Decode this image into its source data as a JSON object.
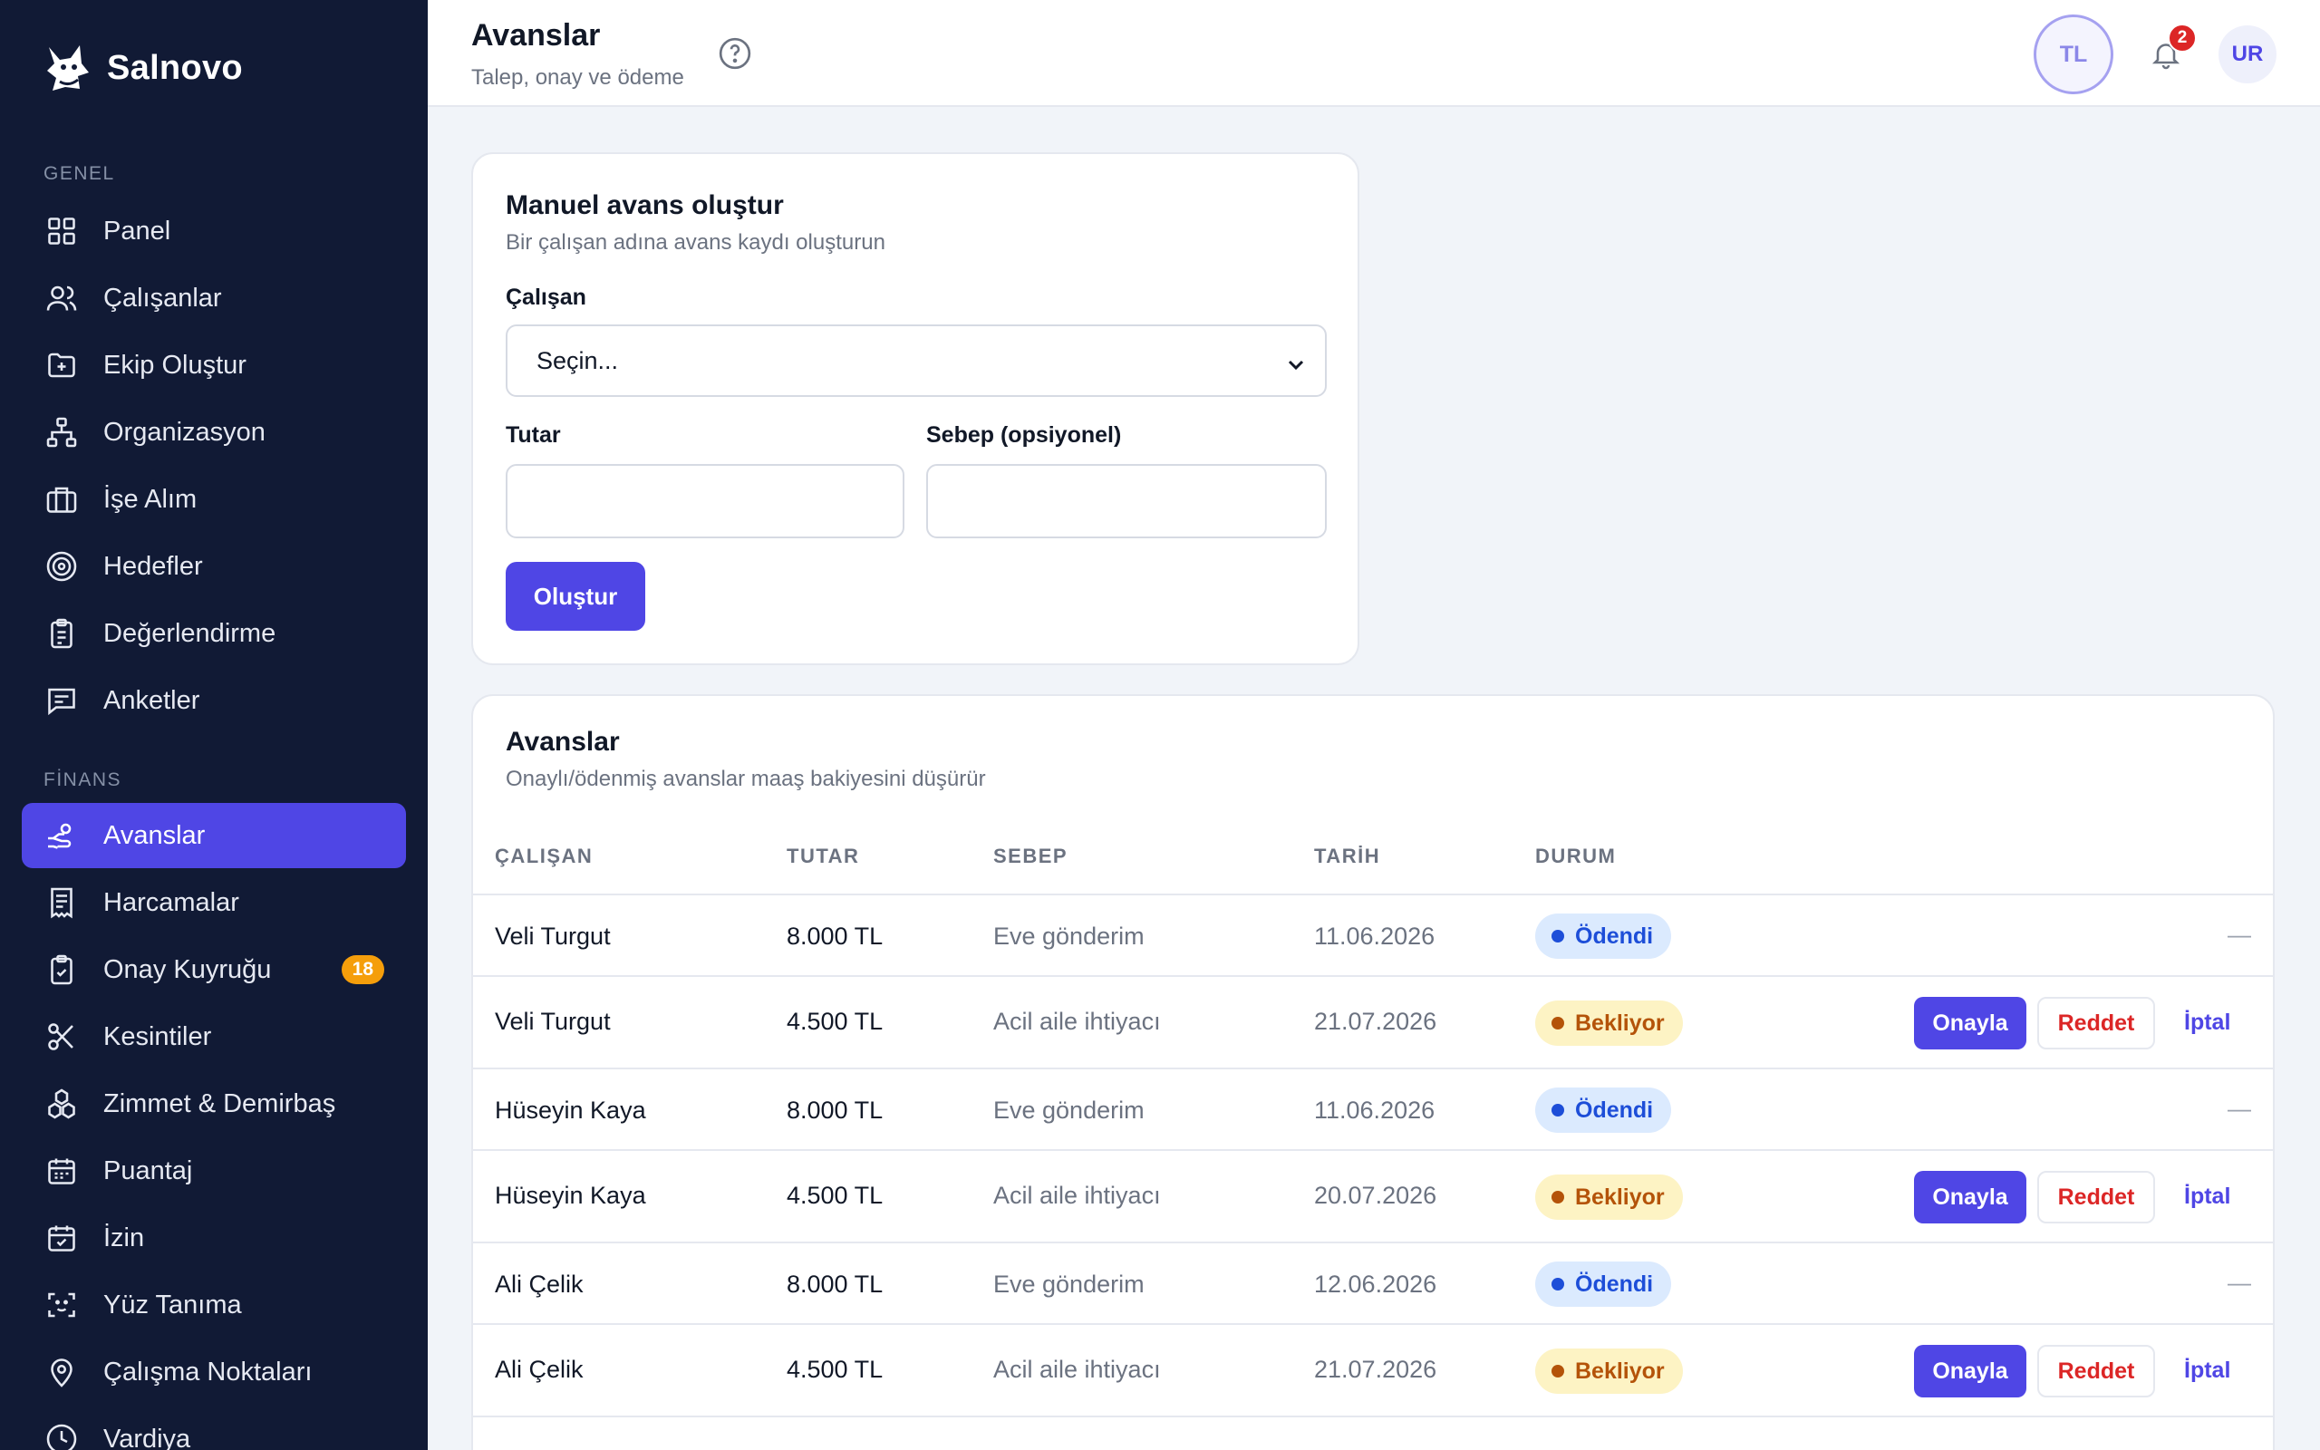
{
  "brand": {
    "name": "Salnovo"
  },
  "sidebar": {
    "sections": [
      {
        "title": "GENEL"
      },
      {
        "title": "FİNANS"
      }
    ],
    "items": [
      {
        "label": "Panel",
        "icon": "grid-icon"
      },
      {
        "label": "Çalışanlar",
        "icon": "users-icon"
      },
      {
        "label": "Ekip Oluştur",
        "icon": "folder-plus-icon"
      },
      {
        "label": "Organizasyon",
        "icon": "org-chart-icon"
      },
      {
        "label": "İşe Alım",
        "icon": "briefcase-icon"
      },
      {
        "label": "Hedefler",
        "icon": "target-icon"
      },
      {
        "label": "Değerlendirme",
        "icon": "clipboard-icon"
      },
      {
        "label": "Anketler",
        "icon": "chat-icon"
      },
      {
        "label": "Avanslar",
        "icon": "hand-coin-icon",
        "active": true
      },
      {
        "label": "Harcamalar",
        "icon": "receipt-icon"
      },
      {
        "label": "Onay Kuyruğu",
        "icon": "clipboard-check-icon",
        "badge": "18"
      },
      {
        "label": "Kesintiler",
        "icon": "scissors-icon"
      },
      {
        "label": "Zimmet & Demirbaş",
        "icon": "boxes-icon"
      },
      {
        "label": "Puantaj",
        "icon": "calendar-icon"
      },
      {
        "label": "İzin",
        "icon": "calendar-check-icon"
      },
      {
        "label": "Yüz Tanıma",
        "icon": "face-scan-icon"
      },
      {
        "label": "Çalışma Noktaları",
        "icon": "map-pin-icon"
      },
      {
        "label": "Vardiya",
        "icon": "clock-icon"
      }
    ]
  },
  "header": {
    "title": "Avanslar",
    "subtitle": "Talep, onay ve ödeme",
    "lang_button": "TL",
    "notification_count": "2",
    "avatar_initials": "UR"
  },
  "form": {
    "title": "Manuel avans oluştur",
    "subtitle": "Bir çalışan adına avans kaydı oluşturun",
    "employee_label": "Çalışan",
    "employee_selected": "Seçin...",
    "amount_label": "Tutar",
    "amount_value": "",
    "reason_label": "Sebep (opsiyonel)",
    "reason_value": "",
    "submit_label": "Oluştur"
  },
  "list": {
    "title": "Avanslar",
    "subtitle": "Onaylı/ödenmiş avanslar maaş bakiyesini düşürür",
    "columns": [
      "ÇALIŞAN",
      "TUTAR",
      "SEBEP",
      "TARİH",
      "DURUM"
    ],
    "actions": {
      "approve": "Onayla",
      "reject": "Reddet",
      "cancel": "İptal",
      "none": "—"
    },
    "rows": [
      {
        "employee": "Veli Turgut",
        "amount": "8.000 TL",
        "reason": "Eve gönderim",
        "date": "11.06.2026",
        "status": "Ödendi"
      },
      {
        "employee": "Veli Turgut",
        "amount": "4.500 TL",
        "reason": "Acil aile ihtiyacı",
        "date": "21.07.2026",
        "status": "Bekliyor"
      },
      {
        "employee": "Hüseyin Kaya",
        "amount": "8.000 TL",
        "reason": "Eve gönderim",
        "date": "11.06.2026",
        "status": "Ödendi"
      },
      {
        "employee": "Hüseyin Kaya",
        "amount": "4.500 TL",
        "reason": "Acil aile ihtiyacı",
        "date": "20.07.2026",
        "status": "Bekliyor"
      },
      {
        "employee": "Ali Çelik",
        "amount": "8.000 TL",
        "reason": "Eve gönderim",
        "date": "12.06.2026",
        "status": "Ödendi"
      },
      {
        "employee": "Ali Çelik",
        "amount": "4.500 TL",
        "reason": "Acil aile ihtiyacı",
        "date": "21.07.2026",
        "status": "Bekliyor"
      }
    ]
  },
  "colors": {
    "sidebar_bg": "#111a35",
    "accent": "#4f46e5",
    "paid": "#1d4ed8",
    "pending": "#b45309",
    "danger": "#dc2626"
  }
}
